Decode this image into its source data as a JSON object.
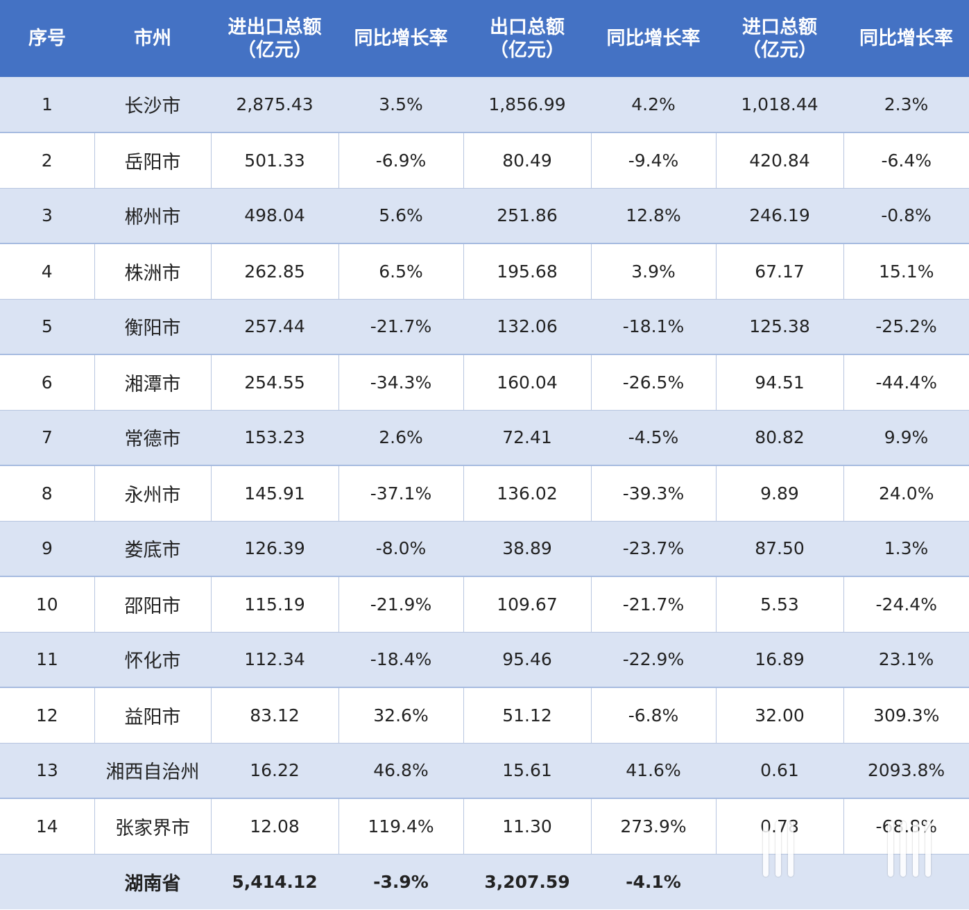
{
  "headers": [
    {
      "line1": "序号",
      "line2": ""
    },
    {
      "line1": "市州",
      "line2": ""
    },
    {
      "line1": "进出口总额",
      "line2": "（亿元）"
    },
    {
      "line1": "同比增长率",
      "line2": ""
    },
    {
      "line1": "出口总额",
      "line2": "（亿元）"
    },
    {
      "line1": "同比增长率",
      "line2": ""
    },
    {
      "line1": "进口总额",
      "line2": "（亿元）"
    },
    {
      "line1": "同比增长率",
      "line2": ""
    }
  ],
  "rows": [
    [
      "1",
      "长沙市",
      "2,875.43",
      "3.5%",
      "1,856.99",
      "4.2%",
      "1,018.44",
      "2.3%"
    ],
    [
      "2",
      "岳阳市",
      "501.33",
      "-6.9%",
      "80.49",
      "-9.4%",
      "420.84",
      "-6.4%"
    ],
    [
      "3",
      "郴州市",
      "498.04",
      "5.6%",
      "251.86",
      "12.8%",
      "246.19",
      "-0.8%"
    ],
    [
      "4",
      "株洲市",
      "262.85",
      "6.5%",
      "195.68",
      "3.9%",
      "67.17",
      "15.1%"
    ],
    [
      "5",
      "衡阳市",
      "257.44",
      "-21.7%",
      "132.06",
      "-18.1%",
      "125.38",
      "-25.2%"
    ],
    [
      "6",
      "湘潭市",
      "254.55",
      "-34.3%",
      "160.04",
      "-26.5%",
      "94.51",
      "-44.4%"
    ],
    [
      "7",
      "常德市",
      "153.23",
      "2.6%",
      "72.41",
      "-4.5%",
      "80.82",
      "9.9%"
    ],
    [
      "8",
      "永州市",
      "145.91",
      "-37.1%",
      "136.02",
      "-39.3%",
      "9.89",
      "24.0%"
    ],
    [
      "9",
      "娄底市",
      "126.39",
      "-8.0%",
      "38.89",
      "-23.7%",
      "87.50",
      "1.3%"
    ],
    [
      "10",
      "邵阳市",
      "115.19",
      "-21.9%",
      "109.67",
      "-21.7%",
      "5.53",
      "-24.4%"
    ],
    [
      "11",
      "怀化市",
      "112.34",
      "-18.4%",
      "95.46",
      "-22.9%",
      "16.89",
      "23.1%"
    ],
    [
      "12",
      "益阳市",
      "83.12",
      "32.6%",
      "51.12",
      "-6.8%",
      "32.00",
      "309.3%"
    ],
    [
      "13",
      "湘西自治州",
      "16.22",
      "46.8%",
      "15.61",
      "41.6%",
      "0.61",
      "2093.8%"
    ],
    [
      "14",
      "张家界市",
      "12.08",
      "119.4%",
      "11.30",
      "273.9%",
      "0.78",
      "-68.8%"
    ]
  ],
  "total": [
    "",
    "湖南省",
    "5,414.12",
    "-3.9%",
    "3,207.59",
    "-4.1%",
    "",
    ""
  ]
}
